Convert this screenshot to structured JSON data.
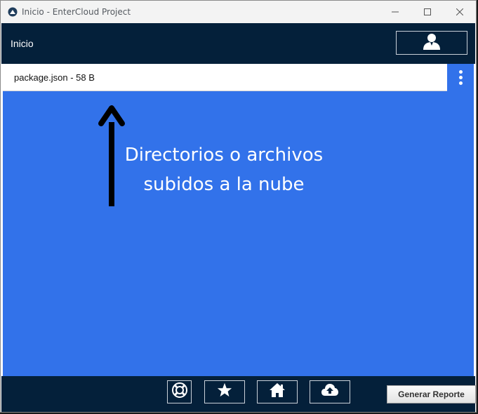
{
  "window": {
    "title": "Inicio - EnterCloud Project",
    "controls": {
      "minimize": "—",
      "maximize": "☐",
      "close": "✕"
    }
  },
  "header": {
    "title": "Inicio",
    "user_icon": "user-icon"
  },
  "file_list": {
    "items": [
      {
        "label": "package.json - 58 B"
      }
    ],
    "menu_icon": "kebab-menu-icon"
  },
  "content": {
    "annotation_line1": "Directorios o archivos",
    "annotation_line2": "subidos a la nube"
  },
  "footer": {
    "icons": [
      "lifebuoy-icon",
      "star-icon",
      "home-icon",
      "cloud-upload-icon"
    ],
    "report_button": "Generar Reporte"
  },
  "colors": {
    "header_bg": "#04203a",
    "content_bg": "#3272ea",
    "titlebar_bg": "#f3f3f3"
  }
}
